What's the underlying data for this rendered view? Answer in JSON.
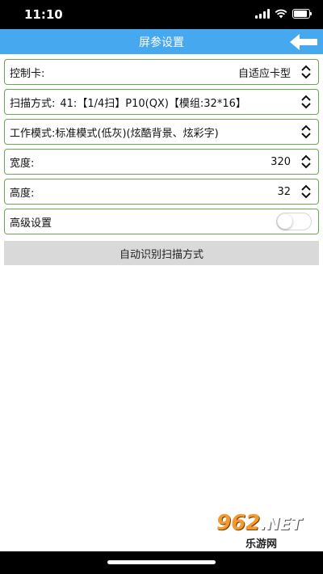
{
  "status_bar": {
    "time": "11:10"
  },
  "nav": {
    "title": "屏参设置"
  },
  "settings": {
    "controller_card": {
      "label": "控制卡:",
      "value": "自适应卡型"
    },
    "scan_mode": {
      "label": "扫描方式:",
      "value": "41:【1/4扫】P10(QX)【模组:32*16】"
    },
    "work_mode": {
      "label": "工作模式:标准模式(低灰)(炫酷背景、炫彩字)"
    },
    "width": {
      "label": "宽度:",
      "value": "320"
    },
    "height": {
      "label": "高度:",
      "value": "32"
    },
    "advanced": {
      "label": "高级设置",
      "enabled": false
    }
  },
  "auto_detect_button": "自动识别扫描方式",
  "watermark": {
    "main": "962",
    "net": ".NET",
    "sub": "乐游网"
  },
  "colors": {
    "nav_bar": "#46a9ef",
    "row_border": "#6aa84f",
    "button_bg": "#d9d9d9"
  }
}
